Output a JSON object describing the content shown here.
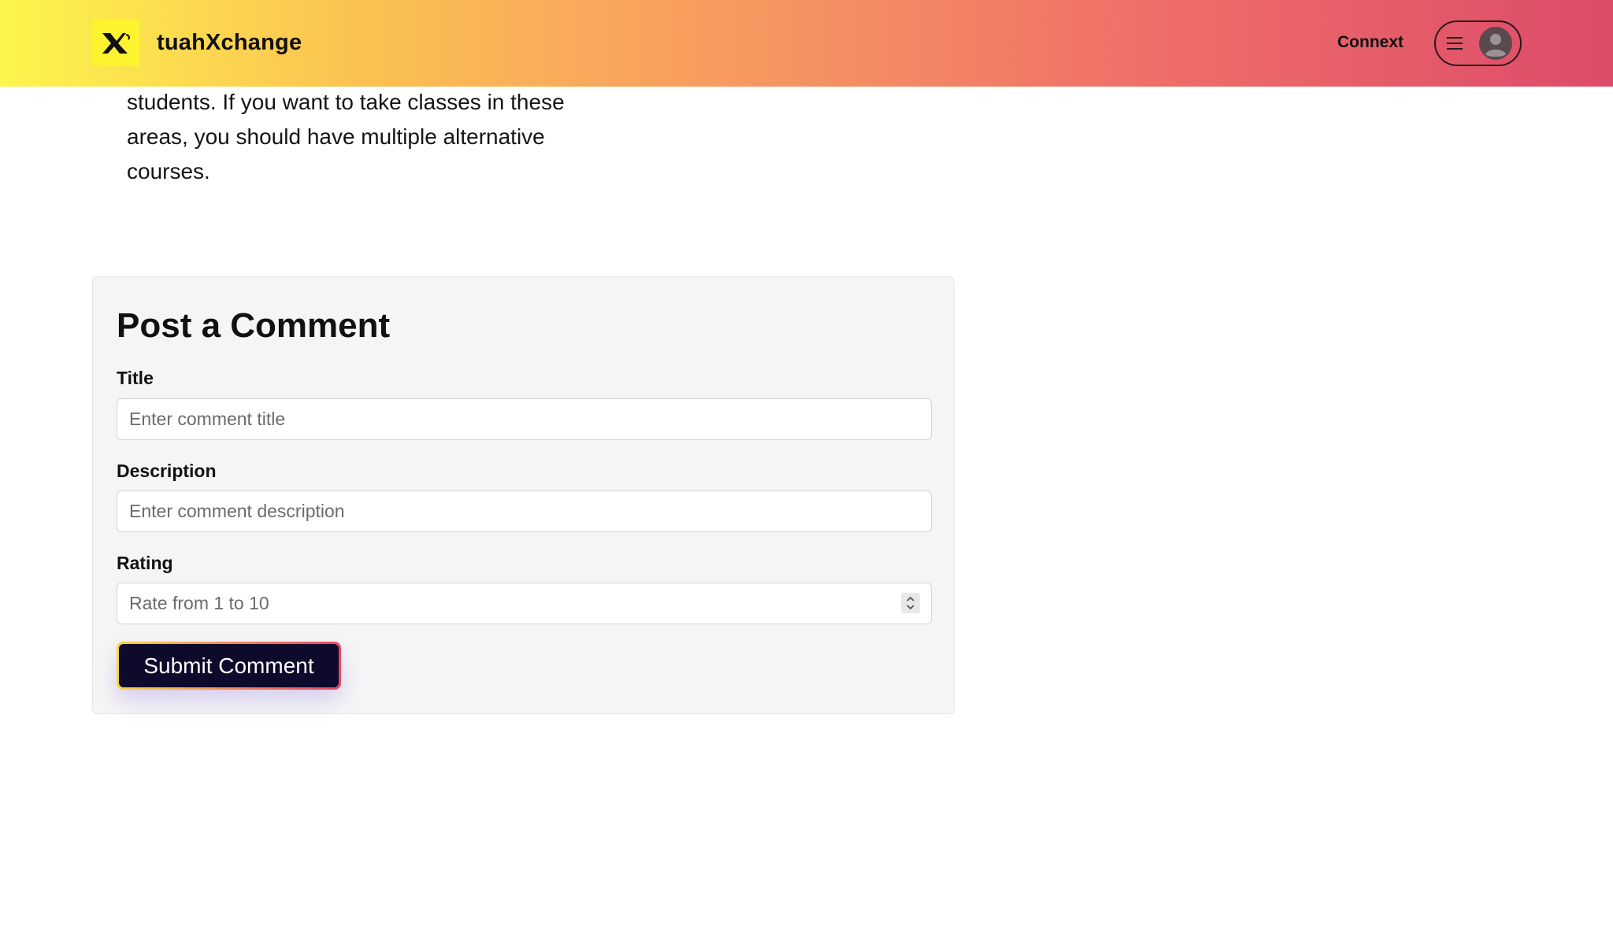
{
  "header": {
    "brand": "tuahXchange",
    "nav_link": "Connext",
    "logo_icon": "x-logo-icon",
    "menu_icon": "hamburger-icon",
    "avatar_icon": "user-avatar-icon"
  },
  "intro": {
    "text": "students. If you want to take classes in these areas, you should have multiple alternative courses."
  },
  "comment_form": {
    "heading": "Post a Comment",
    "title_label": "Title",
    "title_placeholder": "Enter comment title",
    "title_value": "",
    "description_label": "Description",
    "description_placeholder": "Enter comment description",
    "description_value": "",
    "rating_label": "Rating",
    "rating_placeholder": "Rate from 1 to 10",
    "rating_value": "",
    "submit_label": "Submit Comment"
  },
  "colors": {
    "header_gradient_start": "#fdf54d",
    "header_gradient_end": "#dd4b6a",
    "logo_bg": "#fdf32e",
    "button_bg": "#0d0a2b",
    "card_bg": "#f5f5f5"
  }
}
